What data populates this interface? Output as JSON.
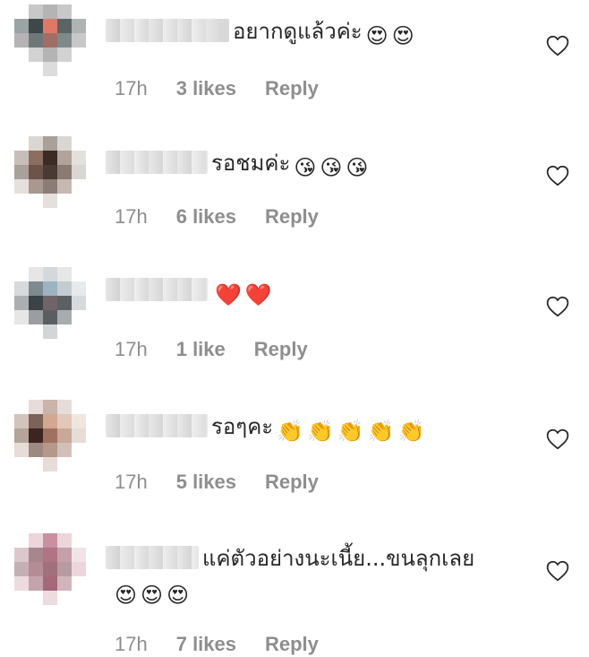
{
  "comments": [
    {
      "username": "",
      "text": "อยากดูแล้วค่ะ",
      "emojis": [
        "😍",
        "😍"
      ],
      "time": "17h",
      "likes": "3 likes",
      "reply": "Reply",
      "avatar_colors": [
        "#ffffff",
        "#c8c8c8",
        "#b4b4b4",
        "#c8c8c8",
        "#ffffff",
        "#9aa4a4",
        "#3e4848",
        "#e07868",
        "#5a6464",
        "#aeb4b2",
        "#b4b4b4",
        "#6e7878",
        "#a06e64",
        "#7e8a8a",
        "#c8c8c8",
        "#ffffff",
        "#d2d2d2",
        "#b4b4b4",
        "#d2d2d2",
        "#ffffff",
        "#ffffff",
        "#ffffff",
        "#dcdcdc",
        "#ffffff",
        "#ffffff"
      ]
    },
    {
      "username": "",
      "text": "รอชมค่ะ",
      "emojis": [
        "😘",
        "😘",
        "😘"
      ],
      "time": "17h",
      "likes": "6 likes",
      "reply": "Reply",
      "avatar_colors": [
        "#ffffff",
        "#dcd6d2",
        "#aaa09a",
        "#dcd6d2",
        "#ffffff",
        "#c8beb8",
        "#8c6e60",
        "#3c2a24",
        "#b0a49a",
        "#e6e0dc",
        "#aaa09a",
        "#6c544a",
        "#4a3a34",
        "#8a7a72",
        "#dcd6d2",
        "#e6e0dc",
        "#a89890",
        "#8a7c76",
        "#c4b8b2",
        "#ffffff",
        "#ffffff",
        "#ffffff",
        "#e6e0dc",
        "#ffffff",
        "#ffffff"
      ]
    },
    {
      "username": "",
      "text": "",
      "emojis": [
        "❤️",
        "❤️"
      ],
      "time": "17h",
      "likes": "1 like",
      "reply": "Reply",
      "avatar_colors": [
        "#ffffff",
        "#e6e6e6",
        "#d2d8dc",
        "#e6e6e6",
        "#ffffff",
        "#d6dadc",
        "#7e8a90",
        "#9ab4c0",
        "#c4ccd0",
        "#e6eaec",
        "#aab0b2",
        "#3c4246",
        "#706468",
        "#5a6064",
        "#d6dadc",
        "#e6e6e6",
        "#9a9ea0",
        "#5a5e62",
        "#a8acae",
        "#ffffff",
        "#ffffff",
        "#ffffff",
        "#d2d6d8",
        "#ffffff",
        "#ffffff"
      ]
    },
    {
      "username": "",
      "text": "รอๆคะ",
      "emojis": [
        "👏",
        "👏",
        "👏",
        "👏",
        "👏"
      ],
      "time": "17h",
      "likes": "5 likes",
      "reply": "Reply",
      "avatar_colors": [
        "#ffffff",
        "#e6dcd8",
        "#c8b4a8",
        "#e6dcd8",
        "#ffffff",
        "#d2c4bc",
        "#7a6458",
        "#d2a890",
        "#e2c8b8",
        "#f0e6e0",
        "#b4a49a",
        "#3c2420",
        "#a07060",
        "#c8a898",
        "#e6dcd8",
        "#e6dcd8",
        "#9c8a80",
        "#b4988a",
        "#d2c0b8",
        "#ffffff",
        "#ffffff",
        "#ffffff",
        "#e6dcd8",
        "#ffffff",
        "#ffffff"
      ]
    },
    {
      "username": "",
      "text": "แค่ตัวอย่างนะเนี้ย...ขนลุกเลย",
      "emojis": [
        "😍",
        "😍",
        "😍"
      ],
      "time": "17h",
      "likes": "7 likes",
      "reply": "Reply",
      "avatar_colors": [
        "#ffffff",
        "#ecd6dc",
        "#c890a0",
        "#ecd6dc",
        "#ffffff",
        "#dcc8cc",
        "#a8868e",
        "#b07484",
        "#c4a0aa",
        "#f0e4e6",
        "#c4b0b4",
        "#b48c96",
        "#a0707c",
        "#b89aa2",
        "#ecd6dc",
        "#ecdce0",
        "#c4a4ac",
        "#a46878",
        "#d2b4bc",
        "#ffffff",
        "#ffffff",
        "#ffffff",
        "#ecdce0",
        "#ffffff",
        "#ffffff"
      ]
    }
  ]
}
